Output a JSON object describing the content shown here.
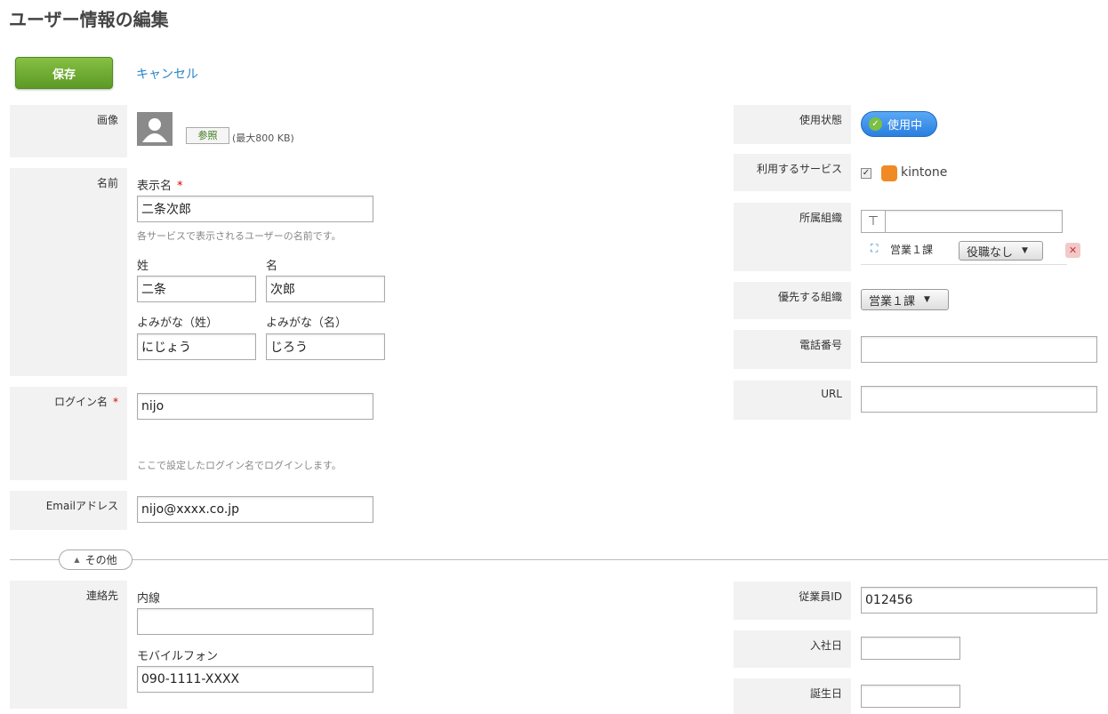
{
  "page": {
    "title": "ユーザー情報の編集"
  },
  "toolbar": {
    "save_label": "保存",
    "cancel_label": "キャンセル"
  },
  "image": {
    "label": "画像",
    "browse_label": "参照",
    "limit": "(最大800 KB)"
  },
  "name": {
    "label": "名前",
    "display_label": "表示名",
    "display_value": "二条次郎",
    "display_hint": "各サービスで表示されるユーザーの名前です。",
    "last_label": "姓",
    "last_value": "二条",
    "first_label": "名",
    "first_value": "次郎",
    "last_kana_label": "よみがな（姓）",
    "last_kana_value": "にじょう",
    "first_kana_label": "よみがな（名）",
    "first_kana_value": "じろう"
  },
  "login": {
    "label": "ログイン名",
    "value": "nijo",
    "hint": "ここで設定したログイン名でログインします。"
  },
  "email": {
    "label": "Emailアドレス",
    "value": "nijo@xxxx.co.jp"
  },
  "other": {
    "toggle_label": "その他"
  },
  "contact": {
    "label": "連絡先",
    "ext_label": "内線",
    "ext_value": "",
    "mobile_label": "モバイルフォン",
    "mobile_value": "090-1111-XXXX"
  },
  "status": {
    "label": "使用状態",
    "value": "使用中"
  },
  "services": {
    "label": "利用するサービス",
    "item": "kintone"
  },
  "org": {
    "label": "所属組織",
    "input_value": "",
    "name": "営業１課",
    "role": "役職なし"
  },
  "priority": {
    "label": "優先する組織",
    "value": "営業１課"
  },
  "phone": {
    "label": "電話番号",
    "value": ""
  },
  "url": {
    "label": "URL",
    "value": ""
  },
  "employee": {
    "label": "従業員ID",
    "value": "012456"
  },
  "join": {
    "label": "入社日",
    "value": ""
  },
  "birthday": {
    "label": "誕生日",
    "value": ""
  },
  "colors": {
    "accent": "#2a86c7",
    "save": "#6aaa2e",
    "status": "#3a8ee6"
  }
}
